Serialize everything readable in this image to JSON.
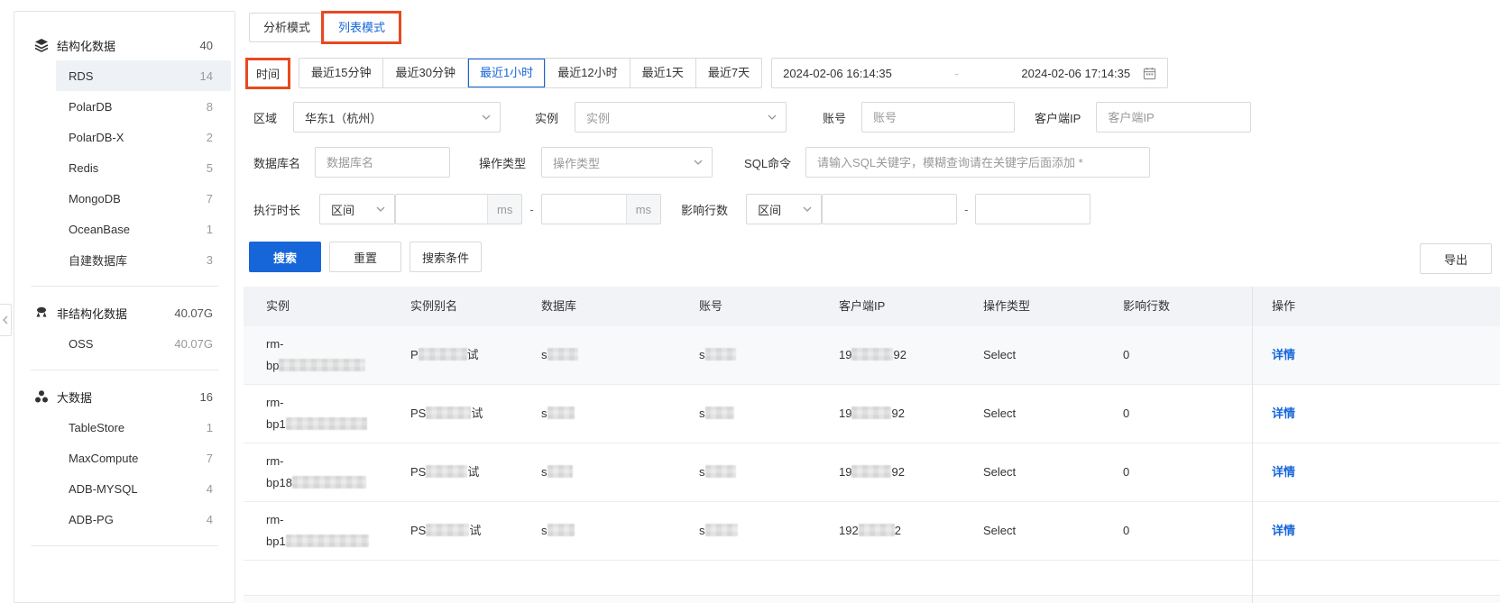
{
  "colors": {
    "primary_blue": "#1766d9",
    "link_blue": "#1766d9",
    "annotation_red": "#e8491f",
    "selected_item_bg": "#eef1f6",
    "table_header_bg": "#f2f3f7"
  },
  "sidebar": {
    "groups": [
      {
        "label": "结构化数据",
        "count": "40",
        "icon": "layers-icon",
        "items": [
          {
            "label": "RDS",
            "count": "14",
            "selected": true
          },
          {
            "label": "PolarDB",
            "count": "8"
          },
          {
            "label": "PolarDB-X",
            "count": "2"
          },
          {
            "label": "Redis",
            "count": "5"
          },
          {
            "label": "MongoDB",
            "count": "7"
          },
          {
            "label": "OceanBase",
            "count": "1"
          },
          {
            "label": "自建数据库",
            "count": "3"
          }
        ]
      },
      {
        "label": "非结构化数据",
        "count": "40.07G",
        "icon": "unstructured-data-icon",
        "items": [
          {
            "label": "OSS",
            "count": "40.07G"
          }
        ]
      },
      {
        "label": "大数据",
        "count": "16",
        "icon": "bigdata-icon",
        "items": [
          {
            "label": "TableStore",
            "count": "1"
          },
          {
            "label": "MaxCompute",
            "count": "7"
          },
          {
            "label": "ADB-MYSQL",
            "count": "4"
          },
          {
            "label": "ADB-PG",
            "count": "4"
          }
        ]
      }
    ]
  },
  "tabs": {
    "analysis": "分析模式",
    "list": "列表模式",
    "active": "列表模式"
  },
  "filters": {
    "time": {
      "label": "时间",
      "presets": [
        "最近15分钟",
        "最近30分钟",
        "最近1小时",
        "最近12小时",
        "最近1天",
        "最近7天"
      ],
      "active_preset": "最近1小时",
      "start": "2024-02-06 16:14:35",
      "end": "2024-02-06 17:14:35",
      "separator": "-"
    },
    "region": {
      "label": "区域",
      "value": "华东1（杭州）"
    },
    "instance": {
      "label": "实例",
      "placeholder": "实例"
    },
    "account": {
      "label": "账号",
      "placeholder": "账号"
    },
    "client_ip": {
      "label": "客户端IP",
      "placeholder": "客户端IP"
    },
    "database": {
      "label": "数据库名",
      "placeholder": "数据库名"
    },
    "op_type": {
      "label": "操作类型",
      "placeholder": "操作类型"
    },
    "sql": {
      "label": "SQL命令",
      "placeholder": "请输入SQL关键字，模糊查询请在关键字后面添加 *"
    },
    "duration": {
      "label": "执行时长",
      "range_option": "区间",
      "unit": "ms",
      "dash": "-"
    },
    "rows_affected": {
      "label": "影响行数",
      "range_option": "区间",
      "dash": "-"
    }
  },
  "actions": {
    "search": "搜索",
    "reset": "重置",
    "conditions": "搜索条件",
    "export": "导出"
  },
  "table": {
    "columns": [
      "实例",
      "实例别名",
      "数据库",
      "账号",
      "客户端IP",
      "操作类型",
      "影响行数",
      "操作"
    ],
    "rows": [
      {
        "instance_l1": "rm-",
        "instance_l2": "bp",
        "alias_pre": "P",
        "alias_suf": "试",
        "db": "s",
        "account": "s",
        "ip_pre": "19",
        "ip_suf": "92",
        "op": "Select",
        "affected": "0",
        "action": "详情"
      },
      {
        "instance_l1": "rm-",
        "instance_l2": "bp1",
        "alias_pre": "PS",
        "alias_suf": "试",
        "db": "s",
        "account": "s",
        "ip_pre": "19",
        "ip_suf": "92",
        "op": "Select",
        "affected": "0",
        "action": "详情"
      },
      {
        "instance_l1": "rm-",
        "instance_l2": "bp18",
        "alias_pre": "PS",
        "alias_suf": "试",
        "db": "s",
        "account": "s",
        "ip_pre": "19",
        "ip_suf": "92",
        "op": "Select",
        "affected": "0",
        "action": "详情"
      },
      {
        "instance_l1": "rm-",
        "instance_l2": "bp1",
        "alias_pre": "PS",
        "alias_suf": "试",
        "db": "s",
        "account": "s",
        "ip_pre": "192",
        "ip_suf": "2",
        "op": "Select",
        "affected": "0",
        "action": "详情"
      }
    ]
  }
}
